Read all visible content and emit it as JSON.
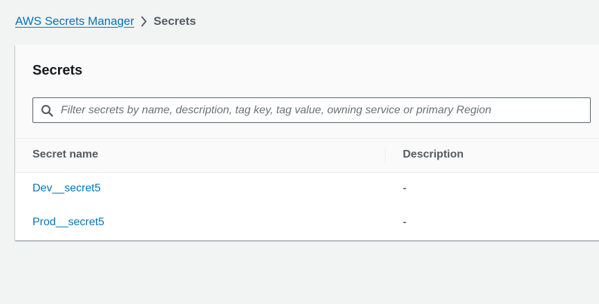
{
  "breadcrumb": {
    "service": "AWS Secrets Manager",
    "current": "Secrets"
  },
  "panel": {
    "title": "Secrets",
    "filter_placeholder": "Filter secrets by name, description, tag key, tag value, owning service or primary Region",
    "filter_value": ""
  },
  "table": {
    "columns": [
      "Secret name",
      "Description"
    ],
    "rows": [
      {
        "name": "Dev__secret5",
        "description": "-"
      },
      {
        "name": "Prod__secret5",
        "description": "-"
      }
    ]
  },
  "icons": {
    "separator": "chevron-right-icon",
    "search": "search-icon"
  },
  "colors": {
    "link": "#0073bb",
    "background": "#f2f3f3",
    "text": "#16191f"
  }
}
